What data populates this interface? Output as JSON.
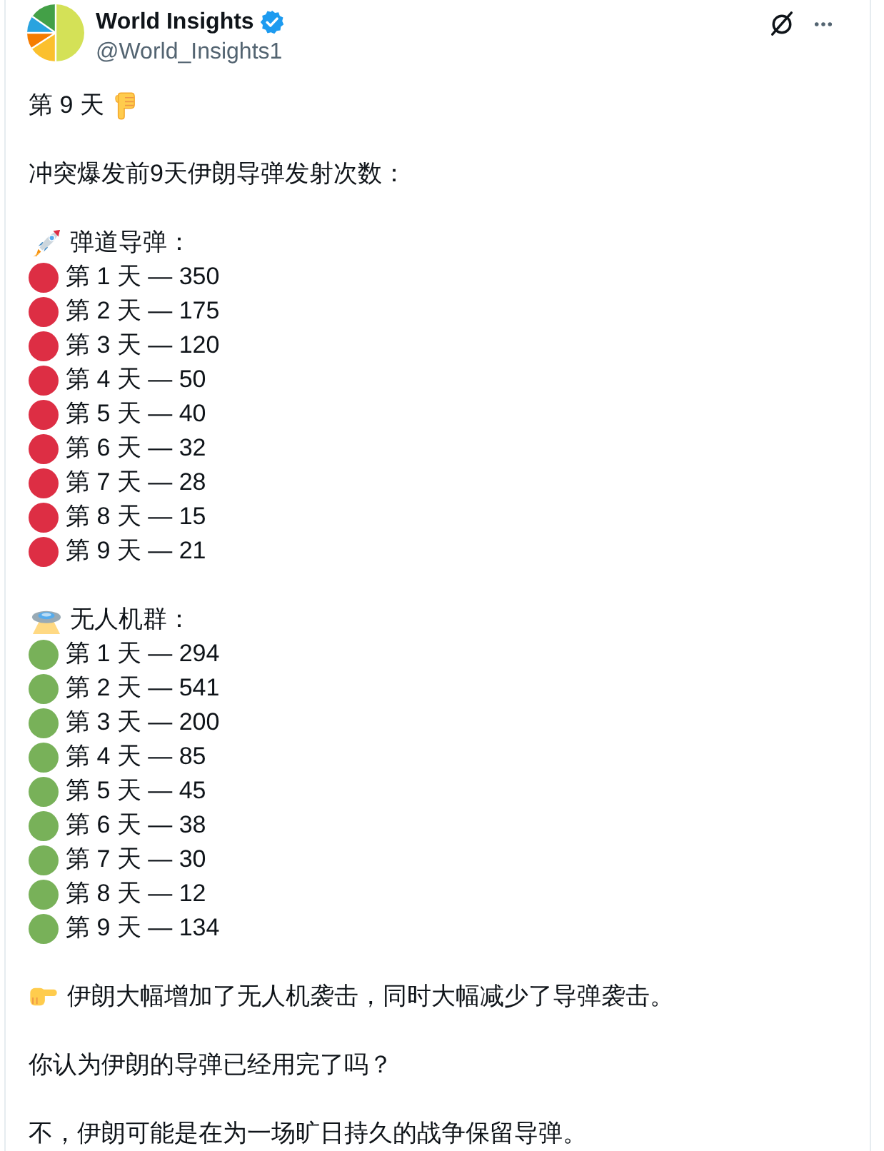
{
  "author": {
    "name": "World Insights",
    "handle": "@World_Insights1",
    "verified": true
  },
  "post": {
    "title": "第 9 天",
    "intro": "冲突爆发前9天伊朗导弹发射次数：",
    "sections": [
      {
        "kind": "missile",
        "heading": "弹道导弹：",
        "color": "#dd2e44",
        "entries": [
          "第 1 天 — 350",
          "第 2 天 — 175",
          "第 3 天 — 120",
          "第 4 天 — 50",
          "第 5 天 — 40",
          "第 6 天 — 32",
          "第 7 天 — 28",
          "第 8 天 — 15",
          "第 9 天 — 21"
        ]
      },
      {
        "kind": "drone",
        "heading": "无人机群：",
        "color": "#78b159",
        "entries": [
          "第 1 天 — 294",
          "第 2 天 — 541",
          "第 3 天 — 200",
          "第 4 天 — 85",
          "第 5 天 — 45",
          "第 6 天 — 38",
          "第 7 天 — 30",
          "第 8 天 — 12",
          "第 9 天 — 134"
        ]
      }
    ],
    "conclusion": "伊朗大幅增加了无人机袭击，同时大幅减少了导弹袭击。",
    "question": "你认为伊朗的导弹已经用完了吗？",
    "answer": "不，伊朗可能是在为一场旷日持久的战争保留导弹。"
  }
}
